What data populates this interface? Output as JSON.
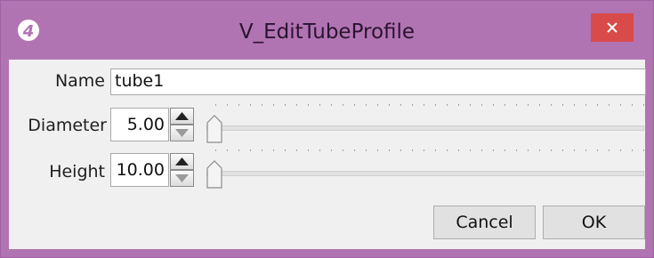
{
  "window": {
    "title": "V_EditTubeProfile",
    "close_symbol": "×",
    "title_bar_color": "#b174b3",
    "close_button_color": "#d94a4a",
    "app_icon": "logo-4-icon"
  },
  "form": {
    "name_label": "Name",
    "name_value": "tube1",
    "diameter_label": "Diameter",
    "diameter_value": "5.00",
    "height_label": "Height",
    "height_value": "10.00"
  },
  "sliders": {
    "diameter_level": 0,
    "height_level": 0
  },
  "buttons": {
    "cancel_label": "Cancel",
    "ok_label": "OK"
  }
}
